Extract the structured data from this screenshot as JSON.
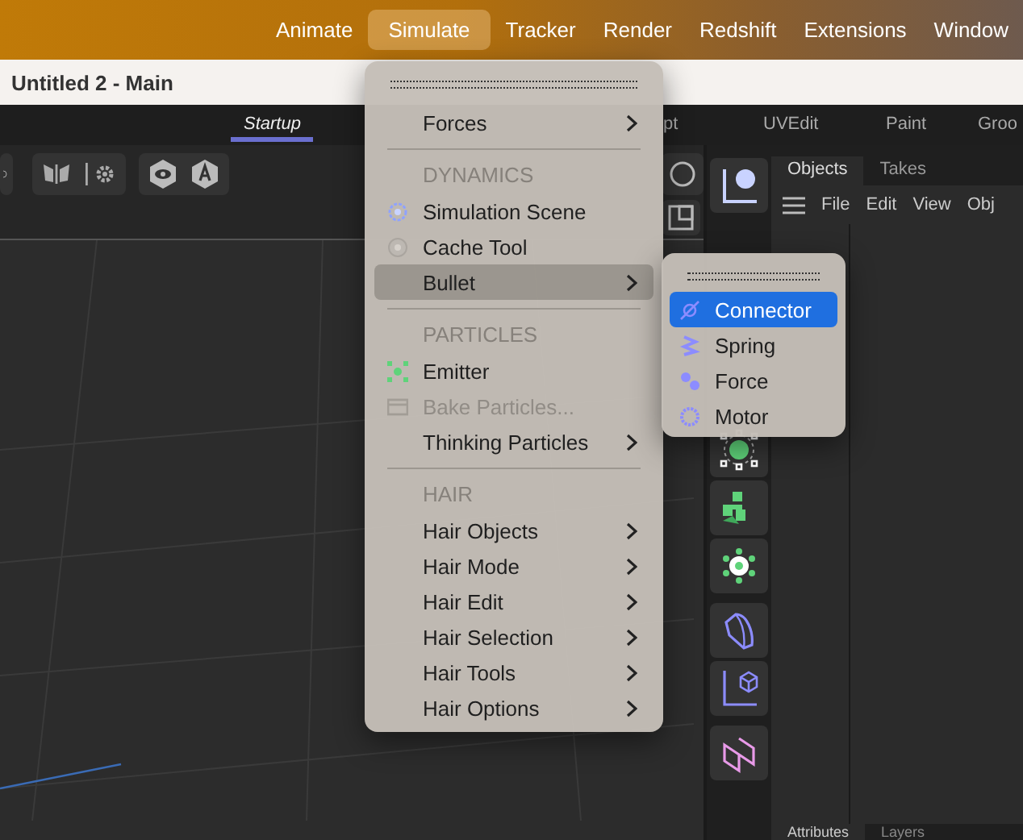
{
  "menubar": {
    "items": [
      {
        "label": "Animate",
        "selected": false
      },
      {
        "label": "Simulate",
        "selected": true
      },
      {
        "label": "Tracker",
        "selected": false
      },
      {
        "label": "Render",
        "selected": false
      },
      {
        "label": "Redshift",
        "selected": false
      },
      {
        "label": "Extensions",
        "selected": false
      },
      {
        "label": "Window",
        "selected": false
      }
    ]
  },
  "document_title": "Untitled 2 - Main",
  "layout_tabs": [
    {
      "label": "Startup",
      "selected": true
    },
    {
      "label": "pt",
      "selected": false
    },
    {
      "label": "UVEdit",
      "selected": false
    },
    {
      "label": "Paint",
      "selected": false
    },
    {
      "label": "Groo",
      "selected": false
    }
  ],
  "right_panel": {
    "tabs": [
      {
        "label": "Objects",
        "selected": true
      },
      {
        "label": "Takes",
        "selected": false
      }
    ],
    "menu": [
      "File",
      "Edit",
      "View",
      "Obj"
    ],
    "bottom_tabs": [
      {
        "label": "Attributes",
        "selected": true
      },
      {
        "label": "Layers",
        "selected": false
      }
    ]
  },
  "simulate_menu": {
    "items": [
      {
        "kind": "item",
        "label": "Forces",
        "submenu": true,
        "selected": false,
        "disabled": false
      },
      {
        "kind": "separator"
      },
      {
        "kind": "header",
        "label": "DYNAMICS"
      },
      {
        "kind": "item",
        "label": "Simulation Scene",
        "submenu": false,
        "selected": false,
        "disabled": false
      },
      {
        "kind": "item",
        "label": "Cache Tool",
        "submenu": false,
        "selected": false,
        "disabled": false
      },
      {
        "kind": "item",
        "label": "Bullet",
        "submenu": true,
        "selected": true,
        "disabled": false
      },
      {
        "kind": "separator"
      },
      {
        "kind": "header",
        "label": "PARTICLES"
      },
      {
        "kind": "item",
        "label": "Emitter",
        "submenu": false,
        "selected": false,
        "disabled": false
      },
      {
        "kind": "item",
        "label": "Bake Particles...",
        "submenu": false,
        "selected": false,
        "disabled": true
      },
      {
        "kind": "item",
        "label": "Thinking Particles",
        "submenu": true,
        "selected": false,
        "disabled": false
      },
      {
        "kind": "separator"
      },
      {
        "kind": "header",
        "label": "HAIR"
      },
      {
        "kind": "item",
        "label": "Hair Objects",
        "submenu": true,
        "selected": false,
        "disabled": false
      },
      {
        "kind": "item",
        "label": "Hair Mode",
        "submenu": true,
        "selected": false,
        "disabled": false
      },
      {
        "kind": "item",
        "label": "Hair Edit",
        "submenu": true,
        "selected": false,
        "disabled": false
      },
      {
        "kind": "item",
        "label": "Hair Selection",
        "submenu": true,
        "selected": false,
        "disabled": false
      },
      {
        "kind": "item",
        "label": "Hair Tools",
        "submenu": true,
        "selected": false,
        "disabled": false
      },
      {
        "kind": "item",
        "label": "Hair Options",
        "submenu": true,
        "selected": false,
        "disabled": false
      }
    ]
  },
  "bullet_submenu": {
    "items": [
      {
        "label": "Connector",
        "selected": true
      },
      {
        "label": "Spring",
        "selected": false
      },
      {
        "label": "Force",
        "selected": false
      },
      {
        "label": "Motor",
        "selected": false
      }
    ]
  }
}
